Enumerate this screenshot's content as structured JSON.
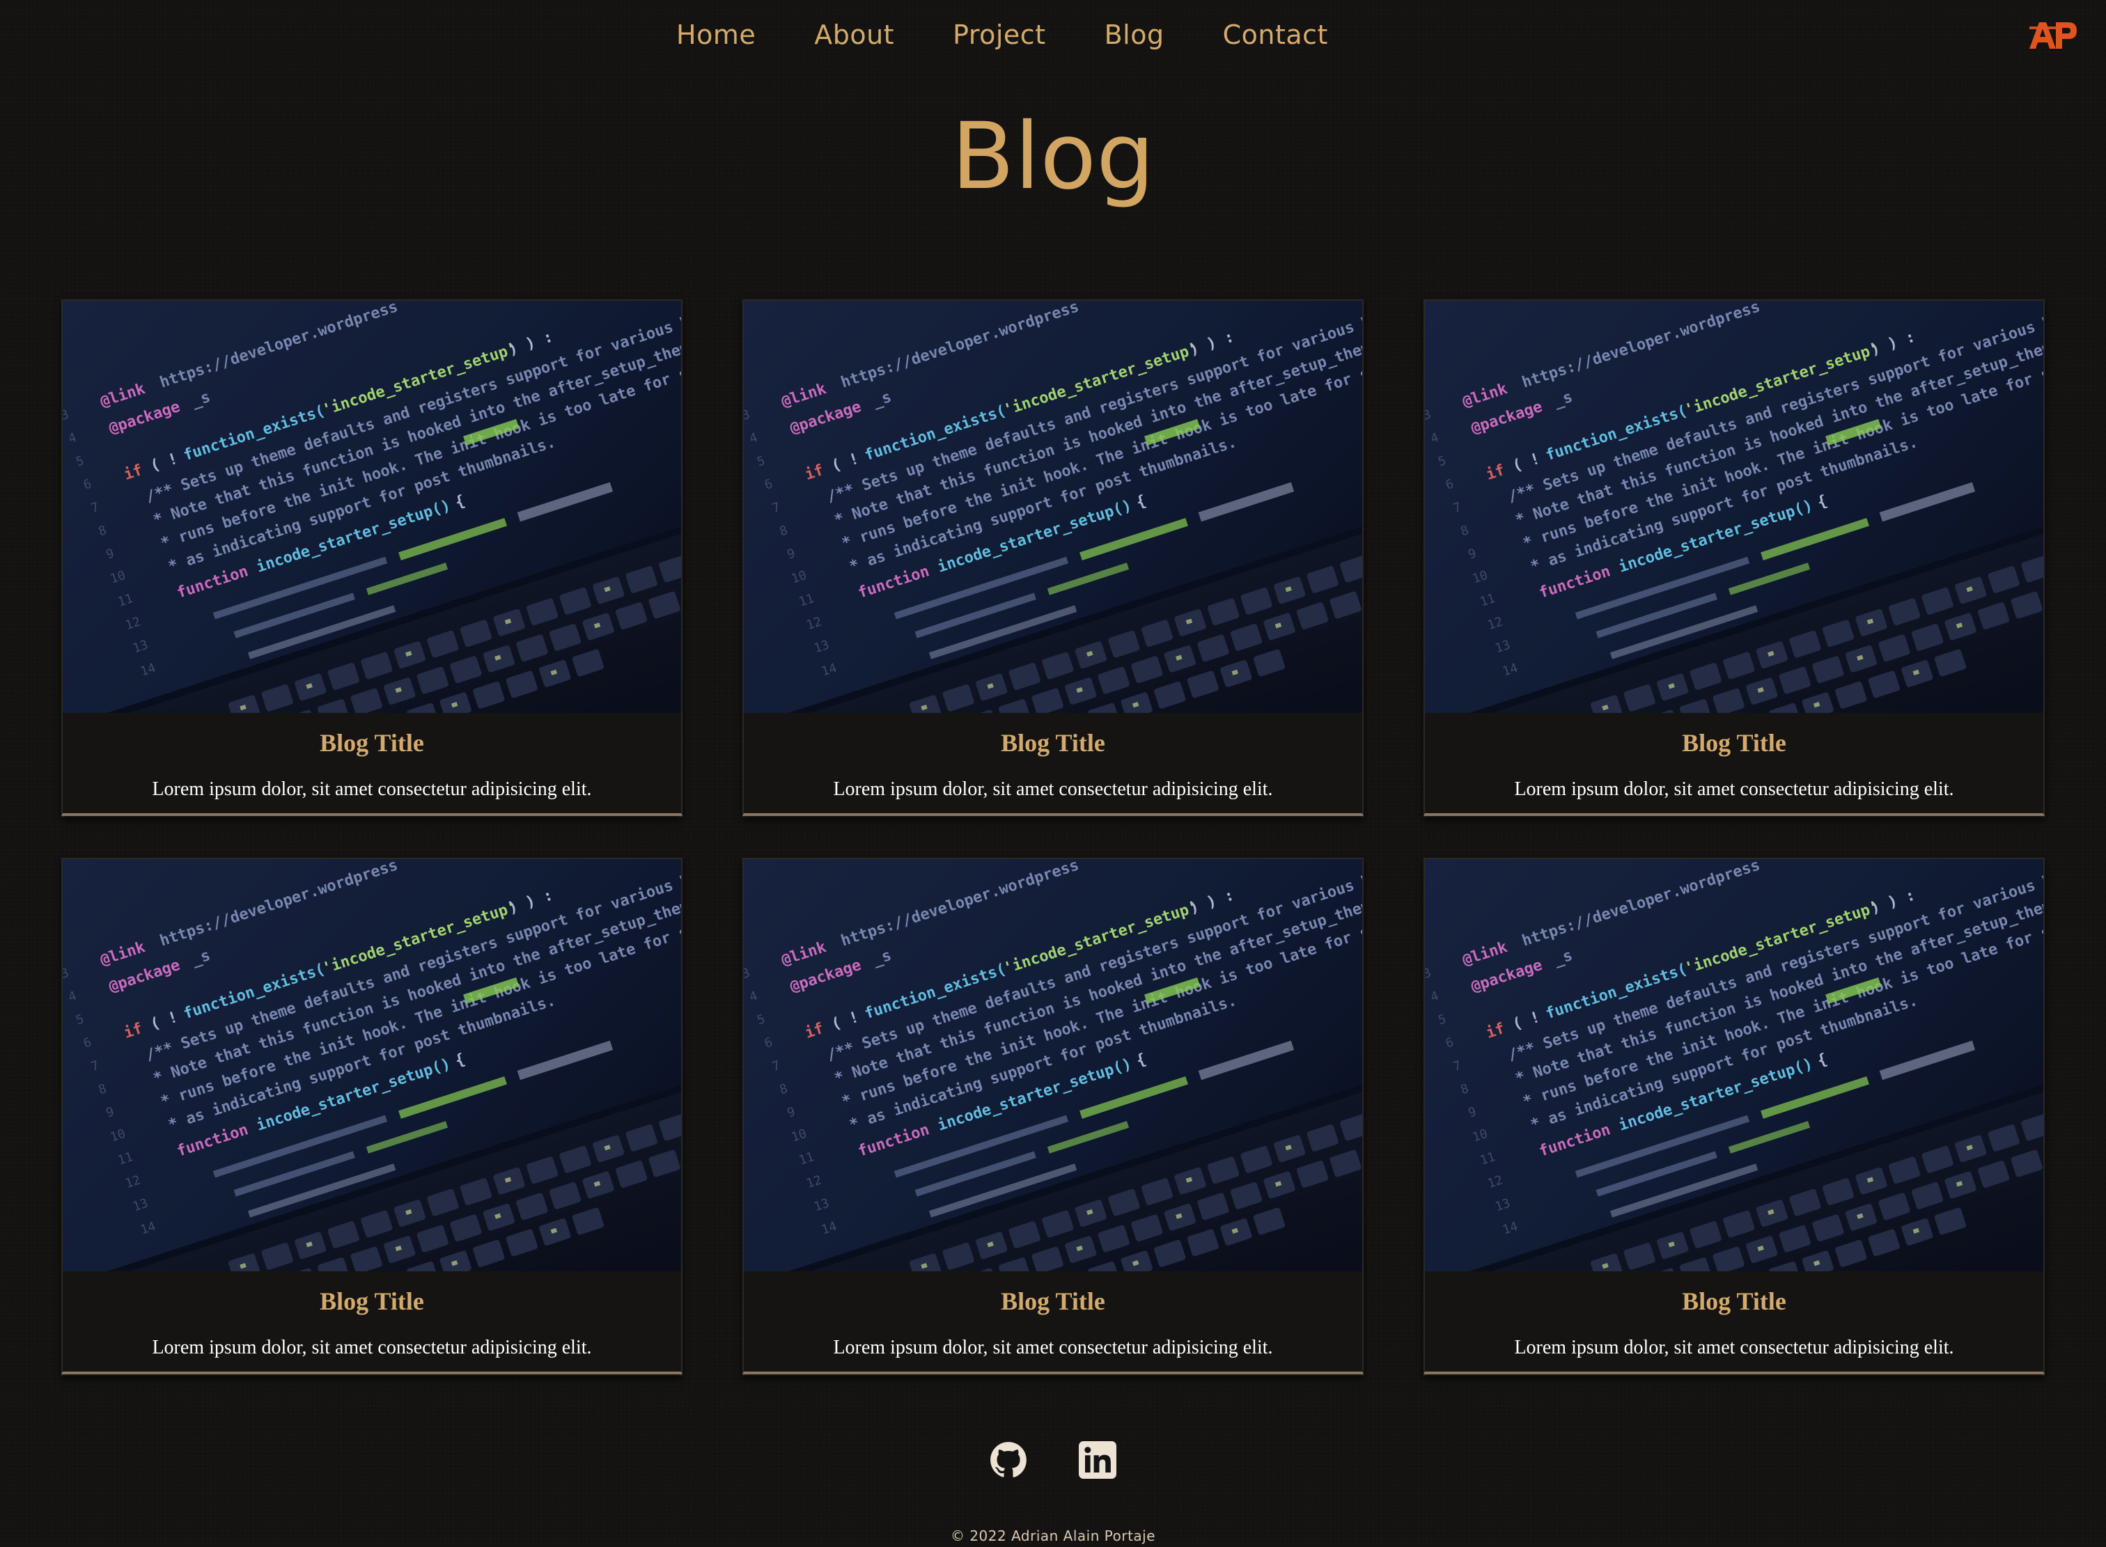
{
  "nav": {
    "items": [
      {
        "label": "Home"
      },
      {
        "label": "About"
      },
      {
        "label": "Project"
      },
      {
        "label": "Blog"
      },
      {
        "label": "Contact"
      }
    ],
    "logo_text": "AP",
    "logo_icon": "ap-logo-icon"
  },
  "page": {
    "title": "Blog"
  },
  "cards": [
    {
      "title": "Blog Title",
      "text": "Lorem ipsum dolor, sit amet consectetur adipisicing elit."
    },
    {
      "title": "Blog Title",
      "text": "Lorem ipsum dolor, sit amet consectetur adipisicing elit."
    },
    {
      "title": "Blog Title",
      "text": "Lorem ipsum dolor, sit amet consectetur adipisicing elit."
    },
    {
      "title": "Blog Title",
      "text": "Lorem ipsum dolor, sit amet consectetur adipisicing elit."
    },
    {
      "title": "Blog Title",
      "text": "Lorem ipsum dolor, sit amet consectetur adipisicing elit."
    },
    {
      "title": "Blog Title",
      "text": "Lorem ipsum dolor, sit amet consectetur adipisicing elit."
    }
  ],
  "social": {
    "github_icon": "github-icon",
    "linkedin_icon": "linkedin-icon"
  },
  "footer": {
    "copyright": "© 2022 Adrian Alain Portaje"
  },
  "colors": {
    "accent": "#d5aa6a",
    "logo": "#e2541f",
    "background": "#141312"
  }
}
